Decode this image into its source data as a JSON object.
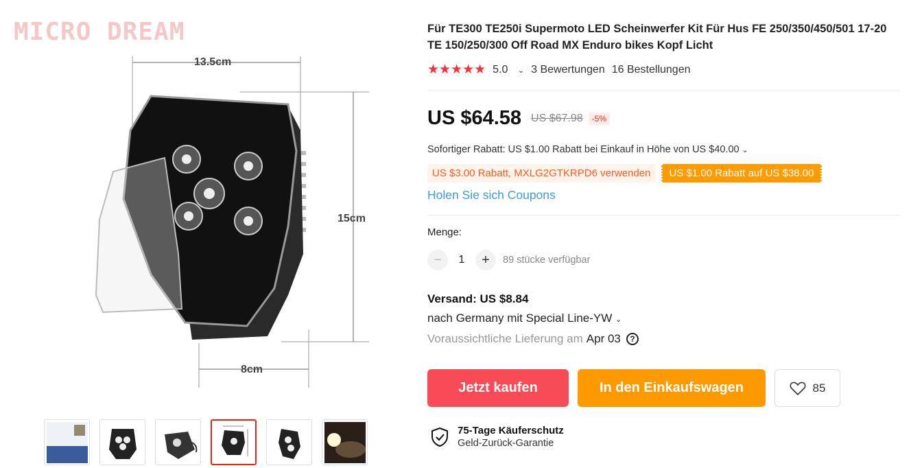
{
  "gallery": {
    "watermark": "MICRO DREAM",
    "dimensions": {
      "width": "13.5cm",
      "height": "15cm",
      "depth": "8cm"
    },
    "thumbnails": [
      {
        "name": "thumb-bike",
        "active": false
      },
      {
        "name": "thumb-front",
        "active": false
      },
      {
        "name": "thumb-side",
        "active": false
      },
      {
        "name": "thumb-dimensions",
        "active": true
      },
      {
        "name": "thumb-angle",
        "active": false
      },
      {
        "name": "thumb-night",
        "active": false
      }
    ]
  },
  "product": {
    "title": "Für TE300 TE250i Supermoto LED Scheinwerfer Kit Für Hus FE 250/350/450/501 17-20 TE 150/250/300 Off Road MX Enduro bikes Kopf Licht",
    "stars": "★★★★★",
    "rating": "5.0",
    "reviews": "3 Bewertungen",
    "orders": "16 Bestellungen",
    "price": "US $64.58",
    "old_price": "US $67.98",
    "discount": "-5%",
    "instant_discount": "Sofortiger Rabatt: US $1.00 Rabatt bei Einkauf in Höhe von US $40.00",
    "coupon_code": "US $3.00 Rabatt, MXLG2GTKRPD6 verwenden",
    "coupon_store": "US $1.00 Rabatt auf US $38.00",
    "get_coupons": "Holen Sie sich Coupons",
    "quantity_label": "Menge:",
    "quantity": "1",
    "available": "89 stücke verfügbar",
    "shipping": "Versand: US $8.84",
    "shipping_dest": "nach Germany mit Special Line-YW",
    "delivery_label": "Voraussichtliche Lieferung am",
    "delivery_date": "Apr 03",
    "buy_now": "Jetzt kaufen",
    "add_to_cart": "In den Einkaufswagen",
    "wishlist_count": "85",
    "protection_title": "75-Tage Käuferschutz",
    "protection_sub": "Geld-Zurück-Garantie"
  },
  "colors": {
    "star": "#f5313a",
    "buy": "#f84b56",
    "cart": "#fe9a00",
    "link": "#3a9fd1"
  }
}
